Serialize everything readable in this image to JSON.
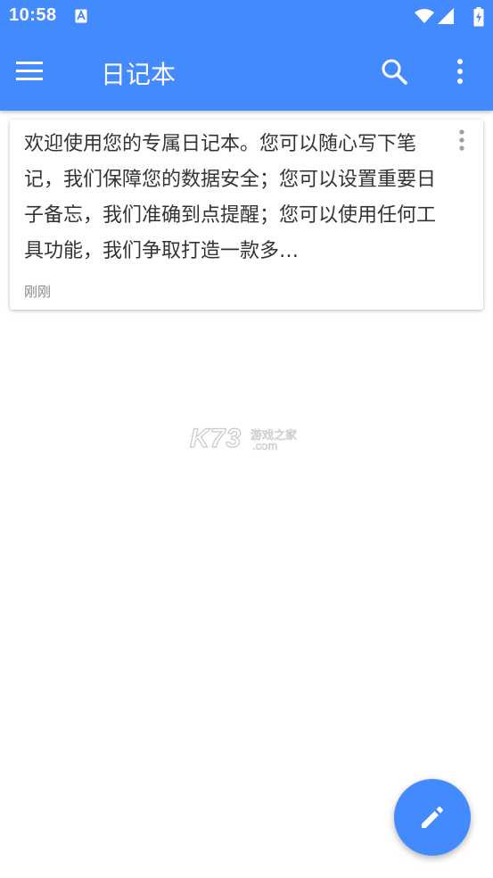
{
  "status_bar": {
    "time": "10:58",
    "notification_icon": "a-icon",
    "icons": [
      "wifi-icon",
      "signal-icon",
      "battery-charging-icon"
    ]
  },
  "app_bar": {
    "title": "日记本",
    "menu_icon": "hamburger-menu-icon",
    "search_icon": "search-icon",
    "more_icon": "more-vertical-icon"
  },
  "notes": [
    {
      "text": "欢迎使用您的专属日记本。您可以随心写下笔记，我们保障您的数据安全；您可以设置重要日子备忘，我们准确到点提醒；您可以使用任何工具功能，我们争取打造一款多…",
      "time": "刚刚"
    }
  ],
  "watermark": {
    "brand": "K73",
    "site": "游戏之家",
    "domain": ".com"
  },
  "fab": {
    "icon": "edit-pencil-icon"
  },
  "colors": {
    "primary": "#448aff",
    "on_primary": "#ffffff",
    "text": "#333333",
    "secondary_text": "#888888"
  }
}
